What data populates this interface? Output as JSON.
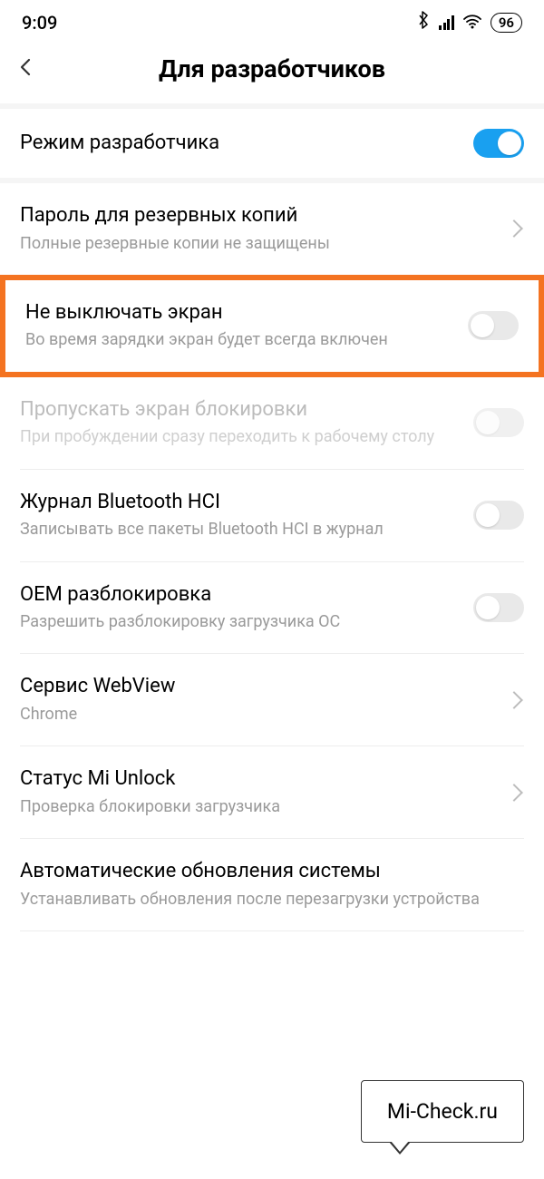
{
  "status": {
    "time": "9:09",
    "battery": "96"
  },
  "header": {
    "title": "Для разработчиков"
  },
  "rows": {
    "dev_mode": {
      "title": "Режим разработчика"
    },
    "backup_pw": {
      "title": "Пароль для резервных копий",
      "sub": "Полные резервные копии не защищены"
    },
    "stay_awake": {
      "title": "Не выключать экран",
      "sub": "Во время зарядки экран будет всегда включен"
    },
    "skip_lock": {
      "title": "Пропускать экран блокировки",
      "sub": "При пробуждении сразу переходить к рабочему столу"
    },
    "bt_hci": {
      "title": "Журнал Bluetooth HCI",
      "sub": "Записывать все пакеты Bluetooth HCI в журнал"
    },
    "oem": {
      "title": "OEM разблокировка",
      "sub": "Разрешить разблокировку загрузчика ОС"
    },
    "webview": {
      "title": "Сервис WebView",
      "sub": "Chrome"
    },
    "mi_unlock": {
      "title": "Статус Mi Unlock",
      "sub": "Проверка блокировки загрузчика"
    },
    "auto_update": {
      "title": "Автоматические обновления системы",
      "sub": "Устанавливать обновления после перезагрузки устройства"
    }
  },
  "callout": "Mi-Check.ru"
}
